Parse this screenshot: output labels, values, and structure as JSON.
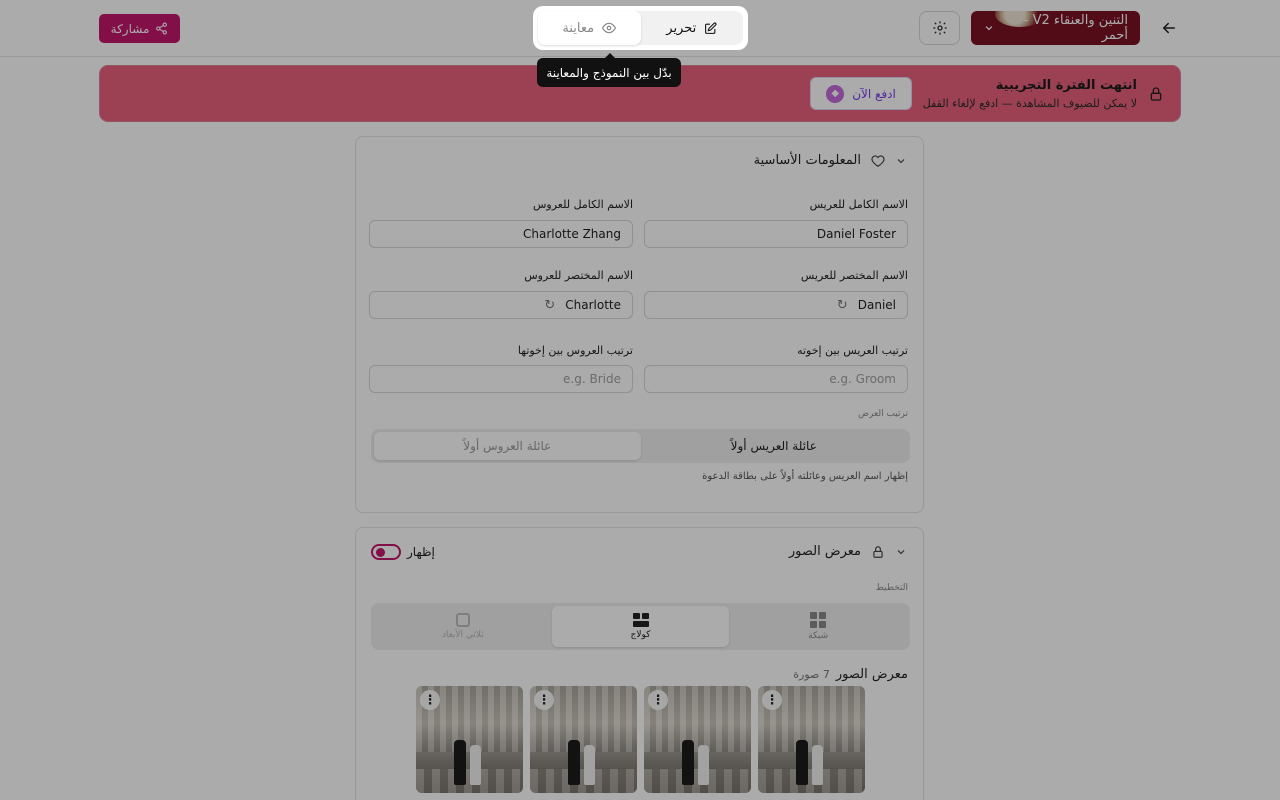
{
  "header": {
    "theme_name": "التنين والعنقاء V2 - أحمر",
    "share_label": "مشاركة",
    "mode_toggle": {
      "edit_label": "تحرير",
      "preview_label": "معاينة"
    },
    "tooltip": "بدّل بين النموذج والمعاينة"
  },
  "banner": {
    "title": "انتهت الفترة التجريبية",
    "subtitle": "لا يمكن للضيوف المشاهدة — ادفع لإلغاء القفل",
    "pay_label": "ادفع الآن",
    "color": "#e8627c"
  },
  "basic_info": {
    "title": "المعلومات الأساسية",
    "groom_full_label": "الاسم الكامل للعريس",
    "groom_full_value": "Daniel Foster",
    "bride_full_label": "الاسم الكامل للعروس",
    "bride_full_value": "Charlotte Zhang",
    "groom_short_label": "الاسم المختصر للعريس",
    "groom_short_value": "Daniel",
    "bride_short_label": "الاسم المختصر للعروس",
    "bride_short_value": "Charlotte",
    "groom_order_label": "ترتيب العريس بين إخوته",
    "groom_order_placeholder": "e.g. Groom",
    "bride_order_label": "ترتيب العروس بين إخوتها",
    "bride_order_placeholder": "e.g. Bride",
    "display_order_label": "ترتيب العرض",
    "groom_first_label": "عائلة العريس أولاً",
    "bride_first_label": "عائلة العروس أولاً",
    "hint": "إظهار اسم العريس وعائلته أولاً على بطاقة الدعوة"
  },
  "gallery": {
    "title": "معرض الصور",
    "show_label": "إظهار",
    "layout_label": "التخطيط",
    "layouts": [
      "شبكة",
      "كولاج",
      "ثلاثي الأبعاد"
    ],
    "active_layout": "كولاج",
    "section_title": "معرض الصور",
    "count": "7 صورة",
    "accent": "#c2176b"
  }
}
